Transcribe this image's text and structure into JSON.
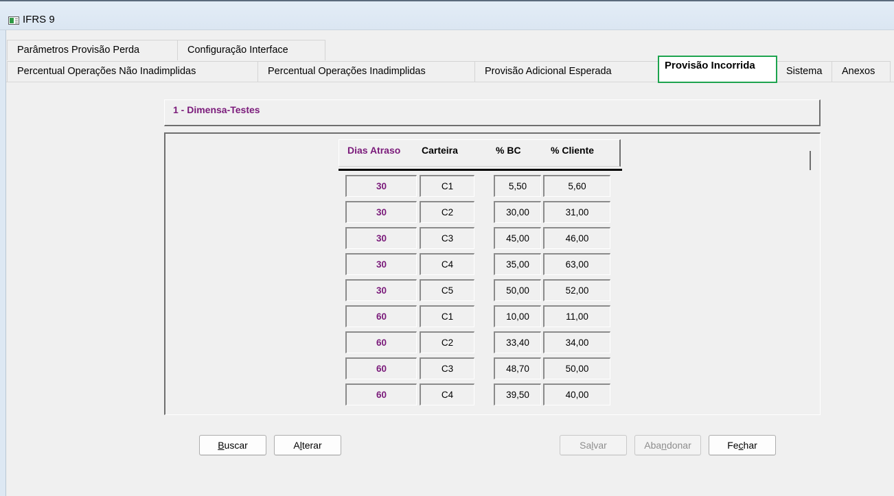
{
  "window": {
    "title": "IFRS 9"
  },
  "tabs_row1": [
    {
      "label": "Parâmetros Provisão Perda"
    },
    {
      "label": "Configuração Interface"
    }
  ],
  "tabs_row2": [
    {
      "label": "Percentual Operações Não Inadimplidas"
    },
    {
      "label": "Percentual Operações Inadimplidas"
    },
    {
      "label": "Provisão Adicional Esperada"
    },
    {
      "label": "Provisão Incorrida",
      "active": true
    },
    {
      "label": "Sistema"
    },
    {
      "label": "Anexos"
    }
  ],
  "group": {
    "title": "1 - Dimensa-Testes"
  },
  "grid": {
    "headers": {
      "dias": "Dias Atraso",
      "carteira": "Carteira",
      "bc": "% BC",
      "cliente": "% Cliente"
    },
    "rows": [
      {
        "dias": "30",
        "carteira": "C1",
        "bc": "5,50",
        "cliente": "5,60"
      },
      {
        "dias": "30",
        "carteira": "C2",
        "bc": "30,00",
        "cliente": "31,00"
      },
      {
        "dias": "30",
        "carteira": "C3",
        "bc": "45,00",
        "cliente": "46,00"
      },
      {
        "dias": "30",
        "carteira": "C4",
        "bc": "35,00",
        "cliente": "63,00"
      },
      {
        "dias": "30",
        "carteira": "C5",
        "bc": "50,00",
        "cliente": "52,00"
      },
      {
        "dias": "60",
        "carteira": "C1",
        "bc": "10,00",
        "cliente": "11,00"
      },
      {
        "dias": "60",
        "carteira": "C2",
        "bc": "33,40",
        "cliente": "34,00"
      },
      {
        "dias": "60",
        "carteira": "C3",
        "bc": "48,70",
        "cliente": "50,00"
      },
      {
        "dias": "60",
        "carteira": "C4",
        "bc": "39,50",
        "cliente": "40,00"
      }
    ]
  },
  "buttons": {
    "buscar": {
      "mnemonic": "B",
      "rest": "uscar",
      "enabled": true
    },
    "alterar": {
      "pre": "A",
      "mnemonic": "l",
      "rest": "terar",
      "enabled": true
    },
    "salvar": {
      "pre": "Sa",
      "mnemonic": "l",
      "rest": "var",
      "enabled": false
    },
    "abandonar": {
      "pre": "Aba",
      "mnemonic": "n",
      "rest": "donar",
      "enabled": false
    },
    "fechar": {
      "pre": "Fe",
      "mnemonic": "c",
      "rest": "har",
      "enabled": true
    }
  },
  "colors": {
    "accent_purple": "#7a1a7a",
    "active_tab_border": "#1ca34d"
  },
  "icons": {
    "window": "form-window-icon"
  }
}
